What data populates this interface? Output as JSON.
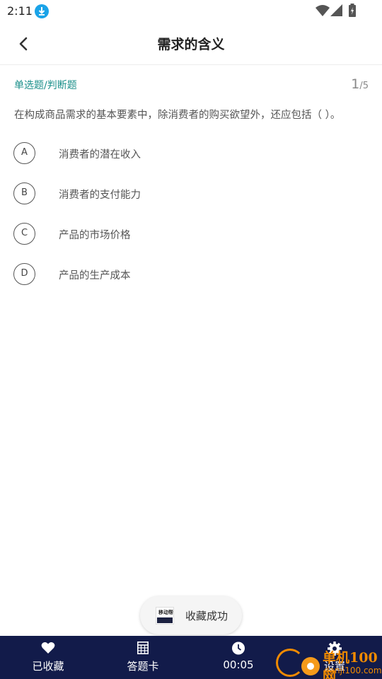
{
  "status_bar": {
    "time": "2:11"
  },
  "header": {
    "title": "需求的含义"
  },
  "question": {
    "type_label": "单选题/判断题",
    "current": "1",
    "total": "/5",
    "text": "在构成商品需求的基本要素中，除消费者的购买欲望外，还应包括（ ）。",
    "options": [
      {
        "letter": "A",
        "text": "消费者的潜在收入"
      },
      {
        "letter": "B",
        "text": "消费者的支付能力"
      },
      {
        "letter": "C",
        "text": "产品的市场价格"
      },
      {
        "letter": "D",
        "text": "产品的生产成本"
      }
    ]
  },
  "toast": {
    "logo_text": "移动帮",
    "message": "收藏成功"
  },
  "bottom_bar": {
    "favorites": "已收藏",
    "answer_card": "答题卡",
    "timer": "00:05",
    "settings": "设置"
  },
  "watermark": {
    "line1": "单机100网",
    "line2": "danji100.com"
  },
  "colors": {
    "accent": "#1a8f8a",
    "bottom_bar": "#121b4a",
    "download_badge": "#1aa3e8",
    "watermark": "#f08a00"
  }
}
